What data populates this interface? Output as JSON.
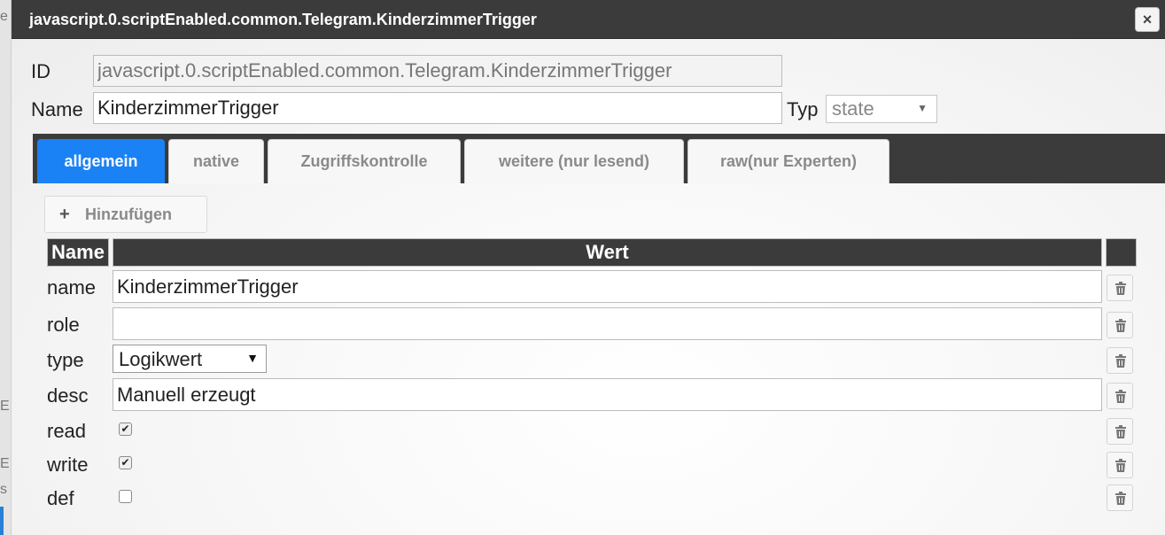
{
  "dialog": {
    "title": "javascript.0.scriptEnabled.common.Telegram.KinderzimmerTrigger",
    "close_icon": "×"
  },
  "form": {
    "id_label": "ID",
    "id_value": "javascript.0.scriptEnabled.common.Telegram.KinderzimmerTrigger",
    "name_label": "Name",
    "name_value": "KinderzimmerTrigger",
    "typ_label": "Typ",
    "typ_value": "state"
  },
  "tabs": [
    {
      "label": "allgemein",
      "active": true
    },
    {
      "label": "native",
      "active": false
    },
    {
      "label": "Zugriffskontrolle",
      "active": false
    },
    {
      "label": "weitere (nur lesend)",
      "active": false
    },
    {
      "label": "raw(nur Experten)",
      "active": false
    }
  ],
  "toolbar": {
    "add_icon": "+",
    "add_label": "Hinzufügen"
  },
  "table": {
    "headers": [
      "Name",
      "Wert",
      ""
    ],
    "rows": [
      {
        "name": "name",
        "kind": "text",
        "value": "KinderzimmerTrigger"
      },
      {
        "name": "role",
        "kind": "text",
        "value": ""
      },
      {
        "name": "type",
        "kind": "select",
        "value": "Logikwert"
      },
      {
        "name": "desc",
        "kind": "text",
        "value": "Manuell erzeugt"
      },
      {
        "name": "read",
        "kind": "checkbox",
        "checked": true
      },
      {
        "name": "write",
        "kind": "checkbox",
        "checked": true
      },
      {
        "name": "def",
        "kind": "checkbox",
        "checked": false
      }
    ]
  },
  "icons": {
    "close": "close-icon",
    "add": "plus-icon",
    "delete": "trash-icon",
    "dropdown": "chevron-down-icon"
  },
  "colors": {
    "accent": "#1a82f4",
    "header_bg": "#3b3b3b"
  }
}
